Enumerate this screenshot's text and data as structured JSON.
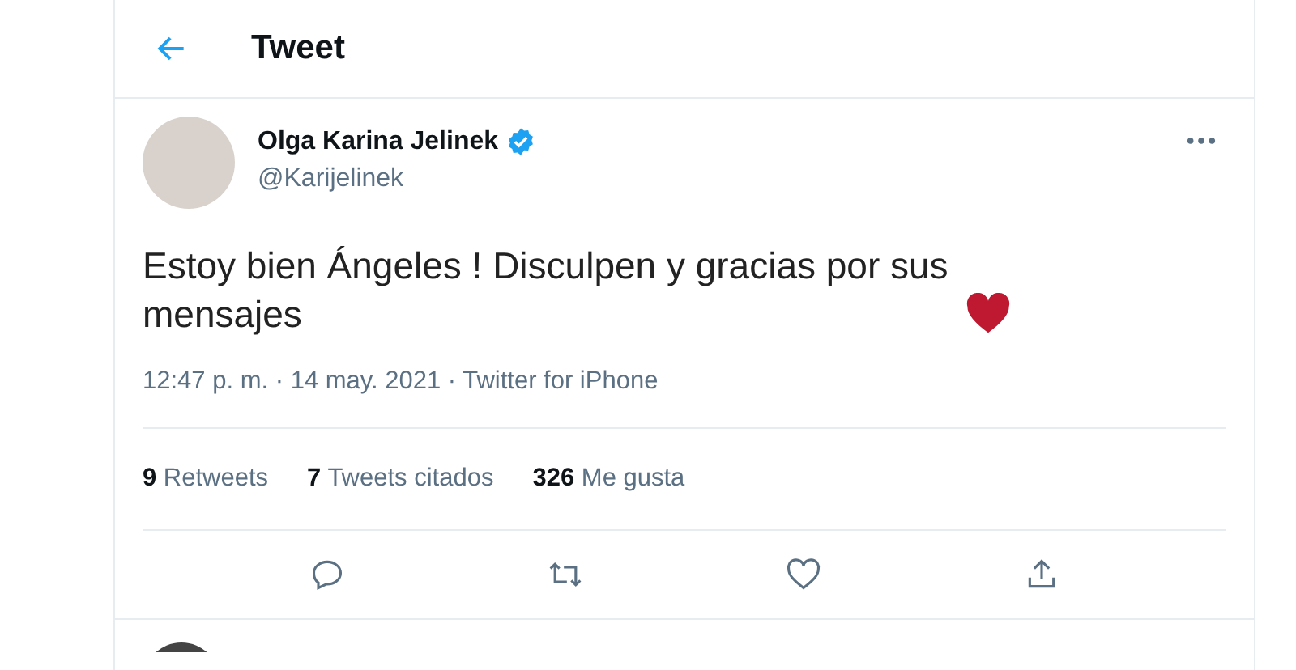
{
  "header": {
    "title": "Tweet"
  },
  "tweet": {
    "author": {
      "name": "Olga Karina Jelinek",
      "verified": true,
      "handle": "@Karijelinek"
    },
    "text": "Estoy bien Ángeles ! Disculpen y gracias por sus mensajes",
    "meta": "12:47 p. m. · 14 may. 2021 · Twitter for iPhone",
    "stats": [
      "**9** Retweets",
      "**7** Tweets citados",
      "**326** Me gusta"
    ]
  }
}
